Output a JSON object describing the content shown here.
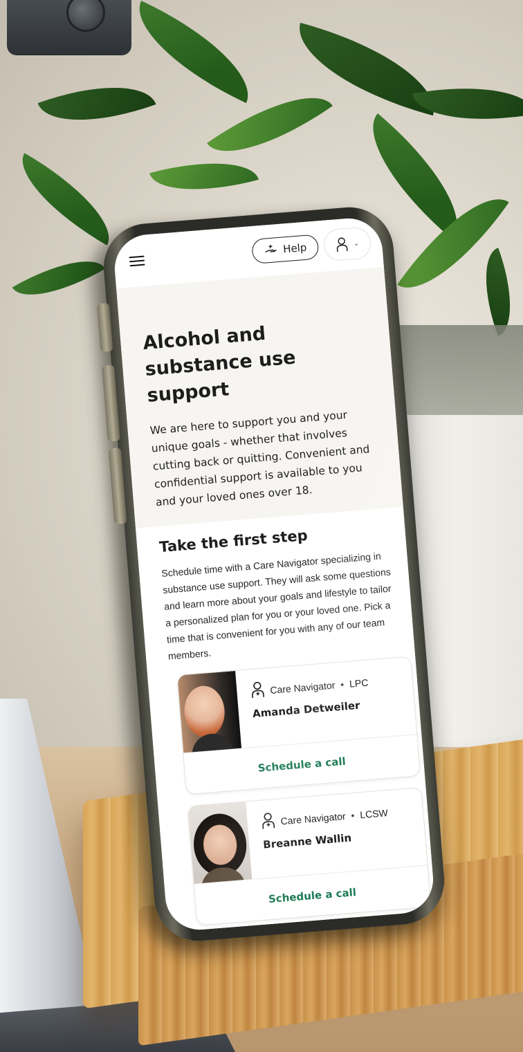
{
  "topbar": {
    "menu_icon": "hamburger-menu-icon",
    "help_label": "Help",
    "help_icon": "hand-heart-icon",
    "profile_icon": "person-icon",
    "profile_caret": "chevron-down-icon"
  },
  "hero": {
    "title": "Alcohol and substance use support",
    "body": "We are here to support you and your unique goals - whether that involves cutting back or quitting. Convenient and confidential support is available to you and your loved ones over 18."
  },
  "first_step": {
    "heading": "Take the first step",
    "body": "Schedule time with a Care Navigator specializing in substance use support. They will ask some questions and learn more about your goals and lifestyle to tailor a personalized plan for you or your loved one. Pick a time that is convenient for you with any of our team members."
  },
  "providers": [
    {
      "role": "Care Navigator",
      "credential": "LPC",
      "name": "Amanda Detweiler",
      "action": "Schedule a call"
    },
    {
      "role": "Care Navigator",
      "credential": "LCSW",
      "name": "Breanne Wallin",
      "action": "Schedule a call"
    }
  ],
  "colors": {
    "accent_green": "#1d7a55",
    "hero_bg": "#f7f5f1"
  }
}
